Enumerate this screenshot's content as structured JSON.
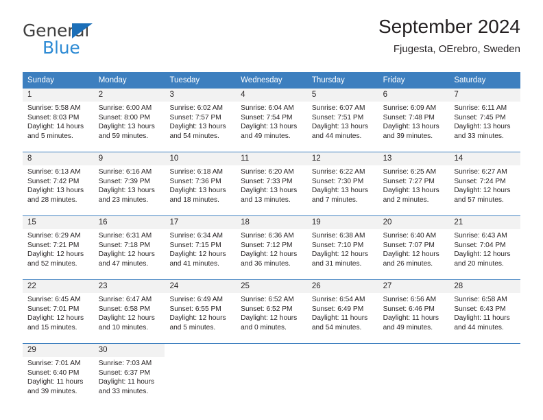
{
  "brand": {
    "name_top": "General",
    "name_bottom": "Blue",
    "accent_color": "#2e8bd4",
    "triangle_color": "#1c6fb8"
  },
  "header": {
    "title": "September 2024",
    "subtitle": "Fjugesta, OErebro, Sweden"
  },
  "theme": {
    "header_bg": "#3d7fbf",
    "daynum_bg": "#f2f2f2",
    "text": "#231f20"
  },
  "calendar": {
    "weekdays": [
      "Sunday",
      "Monday",
      "Tuesday",
      "Wednesday",
      "Thursday",
      "Friday",
      "Saturday"
    ],
    "weeks": [
      [
        {
          "day": "1",
          "sunrise": "Sunrise: 5:58 AM",
          "sunset": "Sunset: 8:03 PM",
          "daylight": "Daylight: 14 hours and 5 minutes."
        },
        {
          "day": "2",
          "sunrise": "Sunrise: 6:00 AM",
          "sunset": "Sunset: 8:00 PM",
          "daylight": "Daylight: 13 hours and 59 minutes."
        },
        {
          "day": "3",
          "sunrise": "Sunrise: 6:02 AM",
          "sunset": "Sunset: 7:57 PM",
          "daylight": "Daylight: 13 hours and 54 minutes."
        },
        {
          "day": "4",
          "sunrise": "Sunrise: 6:04 AM",
          "sunset": "Sunset: 7:54 PM",
          "daylight": "Daylight: 13 hours and 49 minutes."
        },
        {
          "day": "5",
          "sunrise": "Sunrise: 6:07 AM",
          "sunset": "Sunset: 7:51 PM",
          "daylight": "Daylight: 13 hours and 44 minutes."
        },
        {
          "day": "6",
          "sunrise": "Sunrise: 6:09 AM",
          "sunset": "Sunset: 7:48 PM",
          "daylight": "Daylight: 13 hours and 39 minutes."
        },
        {
          "day": "7",
          "sunrise": "Sunrise: 6:11 AM",
          "sunset": "Sunset: 7:45 PM",
          "daylight": "Daylight: 13 hours and 33 minutes."
        }
      ],
      [
        {
          "day": "8",
          "sunrise": "Sunrise: 6:13 AM",
          "sunset": "Sunset: 7:42 PM",
          "daylight": "Daylight: 13 hours and 28 minutes."
        },
        {
          "day": "9",
          "sunrise": "Sunrise: 6:16 AM",
          "sunset": "Sunset: 7:39 PM",
          "daylight": "Daylight: 13 hours and 23 minutes."
        },
        {
          "day": "10",
          "sunrise": "Sunrise: 6:18 AM",
          "sunset": "Sunset: 7:36 PM",
          "daylight": "Daylight: 13 hours and 18 minutes."
        },
        {
          "day": "11",
          "sunrise": "Sunrise: 6:20 AM",
          "sunset": "Sunset: 7:33 PM",
          "daylight": "Daylight: 13 hours and 13 minutes."
        },
        {
          "day": "12",
          "sunrise": "Sunrise: 6:22 AM",
          "sunset": "Sunset: 7:30 PM",
          "daylight": "Daylight: 13 hours and 7 minutes."
        },
        {
          "day": "13",
          "sunrise": "Sunrise: 6:25 AM",
          "sunset": "Sunset: 7:27 PM",
          "daylight": "Daylight: 13 hours and 2 minutes."
        },
        {
          "day": "14",
          "sunrise": "Sunrise: 6:27 AM",
          "sunset": "Sunset: 7:24 PM",
          "daylight": "Daylight: 12 hours and 57 minutes."
        }
      ],
      [
        {
          "day": "15",
          "sunrise": "Sunrise: 6:29 AM",
          "sunset": "Sunset: 7:21 PM",
          "daylight": "Daylight: 12 hours and 52 minutes."
        },
        {
          "day": "16",
          "sunrise": "Sunrise: 6:31 AM",
          "sunset": "Sunset: 7:18 PM",
          "daylight": "Daylight: 12 hours and 47 minutes."
        },
        {
          "day": "17",
          "sunrise": "Sunrise: 6:34 AM",
          "sunset": "Sunset: 7:15 PM",
          "daylight": "Daylight: 12 hours and 41 minutes."
        },
        {
          "day": "18",
          "sunrise": "Sunrise: 6:36 AM",
          "sunset": "Sunset: 7:12 PM",
          "daylight": "Daylight: 12 hours and 36 minutes."
        },
        {
          "day": "19",
          "sunrise": "Sunrise: 6:38 AM",
          "sunset": "Sunset: 7:10 PM",
          "daylight": "Daylight: 12 hours and 31 minutes."
        },
        {
          "day": "20",
          "sunrise": "Sunrise: 6:40 AM",
          "sunset": "Sunset: 7:07 PM",
          "daylight": "Daylight: 12 hours and 26 minutes."
        },
        {
          "day": "21",
          "sunrise": "Sunrise: 6:43 AM",
          "sunset": "Sunset: 7:04 PM",
          "daylight": "Daylight: 12 hours and 20 minutes."
        }
      ],
      [
        {
          "day": "22",
          "sunrise": "Sunrise: 6:45 AM",
          "sunset": "Sunset: 7:01 PM",
          "daylight": "Daylight: 12 hours and 15 minutes."
        },
        {
          "day": "23",
          "sunrise": "Sunrise: 6:47 AM",
          "sunset": "Sunset: 6:58 PM",
          "daylight": "Daylight: 12 hours and 10 minutes."
        },
        {
          "day": "24",
          "sunrise": "Sunrise: 6:49 AM",
          "sunset": "Sunset: 6:55 PM",
          "daylight": "Daylight: 12 hours and 5 minutes."
        },
        {
          "day": "25",
          "sunrise": "Sunrise: 6:52 AM",
          "sunset": "Sunset: 6:52 PM",
          "daylight": "Daylight: 12 hours and 0 minutes."
        },
        {
          "day": "26",
          "sunrise": "Sunrise: 6:54 AM",
          "sunset": "Sunset: 6:49 PM",
          "daylight": "Daylight: 11 hours and 54 minutes."
        },
        {
          "day": "27",
          "sunrise": "Sunrise: 6:56 AM",
          "sunset": "Sunset: 6:46 PM",
          "daylight": "Daylight: 11 hours and 49 minutes."
        },
        {
          "day": "28",
          "sunrise": "Sunrise: 6:58 AM",
          "sunset": "Sunset: 6:43 PM",
          "daylight": "Daylight: 11 hours and 44 minutes."
        }
      ],
      [
        {
          "day": "29",
          "sunrise": "Sunrise: 7:01 AM",
          "sunset": "Sunset: 6:40 PM",
          "daylight": "Daylight: 11 hours and 39 minutes."
        },
        {
          "day": "30",
          "sunrise": "Sunrise: 7:03 AM",
          "sunset": "Sunset: 6:37 PM",
          "daylight": "Daylight: 11 hours and 33 minutes."
        },
        {
          "day": "",
          "sunrise": "",
          "sunset": "",
          "daylight": ""
        },
        {
          "day": "",
          "sunrise": "",
          "sunset": "",
          "daylight": ""
        },
        {
          "day": "",
          "sunrise": "",
          "sunset": "",
          "daylight": ""
        },
        {
          "day": "",
          "sunrise": "",
          "sunset": "",
          "daylight": ""
        },
        {
          "day": "",
          "sunrise": "",
          "sunset": "",
          "daylight": ""
        }
      ]
    ]
  }
}
